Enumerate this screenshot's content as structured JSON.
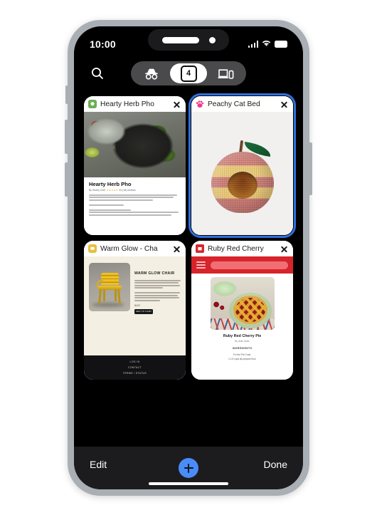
{
  "status_bar": {
    "time": "10:00",
    "icons": [
      "cellular-signal-icon",
      "wifi-icon",
      "battery-icon"
    ]
  },
  "top_bar": {
    "search_icon": "search-icon",
    "segments": [
      {
        "id": "incognito",
        "icon": "incognito-icon",
        "label": "",
        "selected": false
      },
      {
        "id": "tabs",
        "icon": "tab-count-icon",
        "label": "4",
        "selected": true
      },
      {
        "id": "devices",
        "icon": "devices-icon",
        "label": "",
        "selected": false
      }
    ]
  },
  "tabs": [
    {
      "title": "Hearty Herb Pho",
      "favicon": "leaf-favicon",
      "favicon_color": "#6cae52",
      "selected": false,
      "close_label": "close-tab",
      "page": {
        "heading": "Hearty Herb Pho",
        "byline": "By Hearty Chef",
        "rating_stars": 5,
        "reviews": "44 (18) reviews"
      }
    },
    {
      "title": "Peachy Cat Bed",
      "favicon": "cat-paw-favicon",
      "favicon_color": "#ef3d8c",
      "selected": true,
      "close_label": "close-tab",
      "page": {
        "heading": "",
        "byline": "",
        "rating_stars": 0,
        "reviews": ""
      }
    },
    {
      "title": "Warm Glow - Cha",
      "favicon": "chat-favicon",
      "favicon_color": "#e8bf3e",
      "selected": false,
      "close_label": "close-tab",
      "page": {
        "heading": "WARM GLOW CHAIR",
        "price": "$420",
        "button": "ADD TO CART",
        "footer_links": [
          "LOG IN",
          "CONTACT",
          "TERMS / STATUS"
        ]
      }
    },
    {
      "title": "Ruby Red Cherry",
      "favicon": "calendar-favicon",
      "favicon_color": "#d9272e",
      "selected": false,
      "close_label": "close-tab",
      "page": {
        "heading": "Ruby Red Cherry Pie",
        "byline": "By Julia Jones",
        "section": "INGREDIENTS",
        "items": [
          "For the Pie Crust:",
          "2 1/2 cups all-purpose flour"
        ]
      }
    }
  ],
  "bottom_bar": {
    "edit_label": "Edit",
    "done_label": "Done",
    "new_tab_icon": "plus-icon",
    "new_tab_color": "#4a8cf7"
  },
  "theme": {
    "screen_background": "#000000",
    "frame_color": "#a9afb4",
    "selected_tab_outline": "#2f6fdd",
    "toolbar_background": "#1c1c1e"
  }
}
